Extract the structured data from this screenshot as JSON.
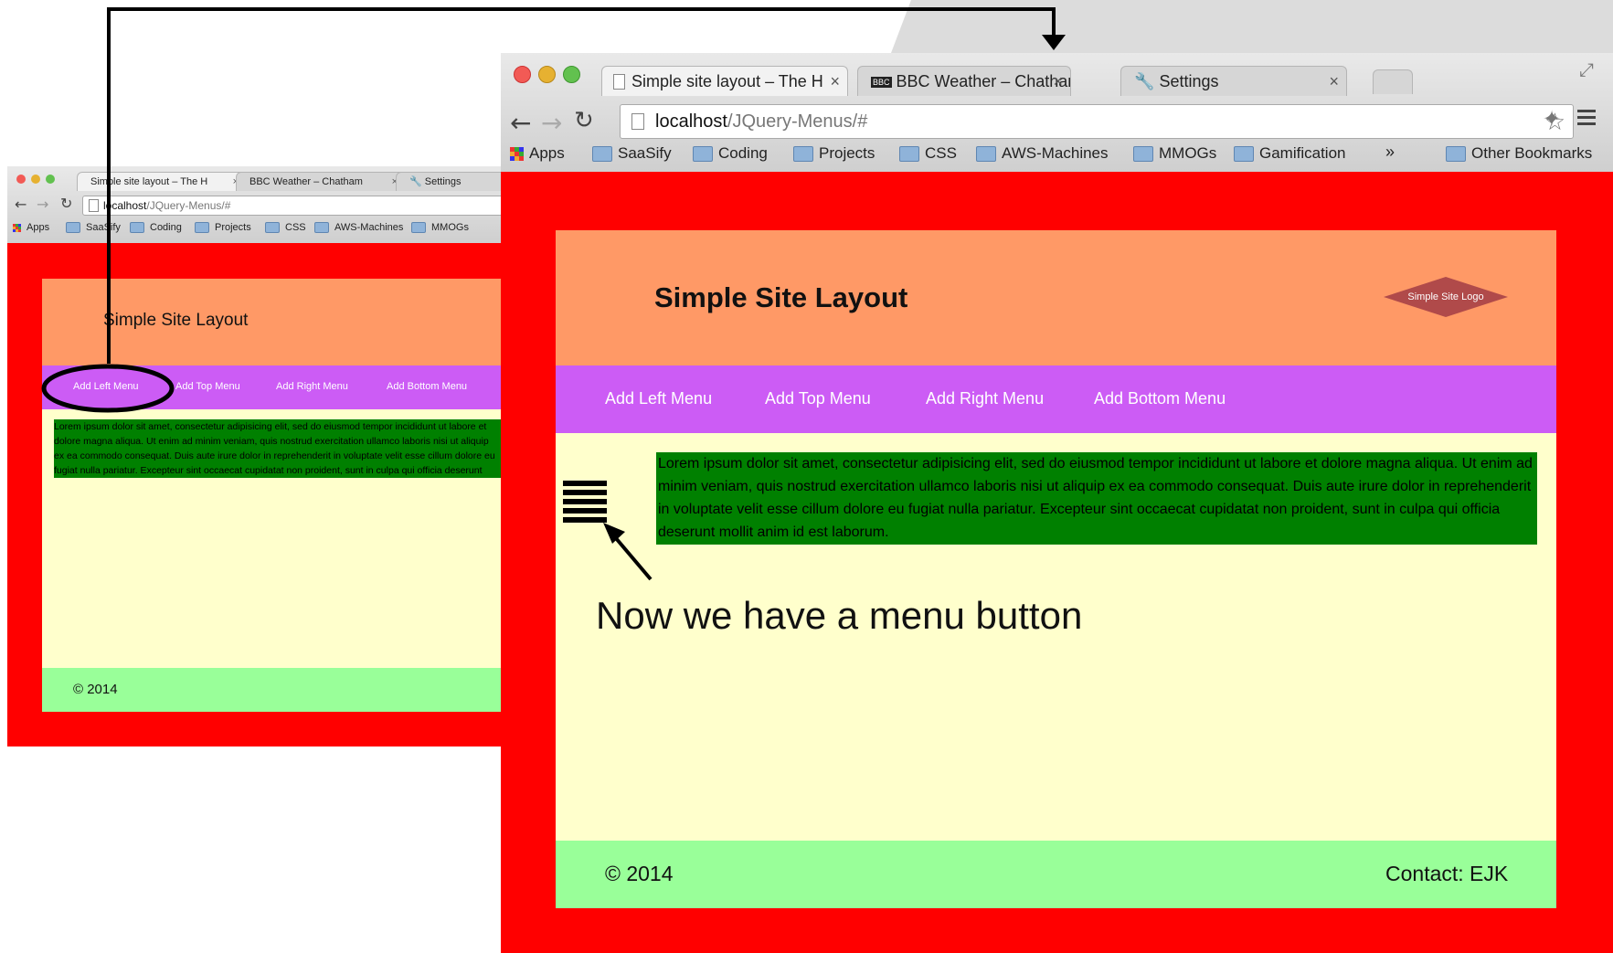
{
  "small_browser": {
    "tabs": [
      {
        "label": "Simple site layout – The H",
        "close": "×"
      },
      {
        "label": "BBC Weather – Chatham",
        "close": "×"
      },
      {
        "label": "Settings"
      }
    ],
    "address": {
      "host": "localhost",
      "path": "/JQuery-Menus/#"
    },
    "bookmarks": [
      "Apps",
      "SaaSify",
      "Coding",
      "Projects",
      "CSS",
      "AWS-Machines",
      "MMOGs"
    ],
    "site": {
      "title": "Simple Site Layout",
      "nav": [
        "Add Left Menu",
        "Add Top Menu",
        "Add Right Menu",
        "Add Bottom Menu"
      ],
      "lorem": "Lorem ipsum dolor sit amet, consectetur adipisicing elit, sed do eiusmod tempor incididunt ut labore et dolore magna aliqua. Ut enim ad minim veniam, quis nostrud exercitation ullamco laboris nisi ut aliquip ex ea commodo consequat. Duis aute irure dolor in reprehenderit in voluptate velit esse cillum dolore eu fugiat nulla pariatur. Excepteur sint occaecat cupidatat non proident, sunt in culpa qui officia deserunt mollit anim id est laborum.",
      "footer": "© 2014"
    }
  },
  "large_browser": {
    "tabs": [
      {
        "label": "Simple site layout – The H",
        "close": "×"
      },
      {
        "label": "BBC Weather – Chatham",
        "badge": "BBC",
        "close": "×"
      },
      {
        "label": "Settings",
        "close": "×"
      }
    ],
    "address": {
      "host": "localhost",
      "path": "/JQuery-Menus/#"
    },
    "bookmarks": [
      "Apps",
      "SaaSify",
      "Coding",
      "Projects",
      "CSS",
      "AWS-Machines",
      "MMOGs",
      "Gamification"
    ],
    "bookmarks_overflow": "»",
    "other_bookmarks": "Other Bookmarks",
    "site": {
      "title": "Simple Site Layout",
      "logo": "Simple Site Logo",
      "nav": [
        "Add Left Menu",
        "Add Top Menu",
        "Add Right Menu",
        "Add Bottom Menu"
      ],
      "lorem": "Lorem ipsum dolor sit amet, consectetur adipisicing elit, sed do eiusmod tempor incididunt ut labore et dolore magna aliqua. Ut enim ad minim veniam, quis nostrud exercitation ullamco laboris nisi ut aliquip ex ea commodo consequat. Duis aute irure dolor in reprehenderit in voluptate velit esse cillum dolore eu fugiat nulla pariatur. Excepteur sint occaecat cupidatat non proident, sunt in culpa qui officia deserunt mollit anim id est laborum.",
      "footer_left": "© 2014",
      "footer_right": "Contact: EJK"
    }
  },
  "annotation": "Now we have a menu button",
  "colors": {
    "page_border": "#ff0000",
    "header": "#ff9966",
    "nav": "#cc5cf5",
    "content": "#ffffcc",
    "lorem_box": "#008000",
    "footer": "#99ff99",
    "logo": "#b04a4a"
  },
  "icons": [
    "hamburger-menu-icon",
    "back-arrow-icon",
    "forward-arrow-icon",
    "reload-icon",
    "page-icon",
    "star-icon",
    "extension-icon",
    "chrome-menu-icon",
    "folder-icon",
    "apps-grid-icon",
    "wrench-icon"
  ]
}
